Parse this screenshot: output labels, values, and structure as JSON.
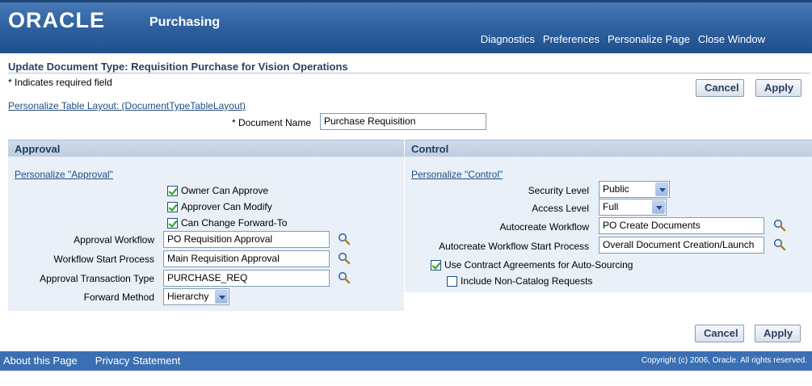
{
  "header": {
    "logo": "ORACLE",
    "app_name": "Purchasing",
    "global_links": [
      "Diagnostics",
      "Preferences",
      "Personalize Page",
      "Close Window"
    ]
  },
  "page": {
    "title": "Update Document Type: Requisition Purchase for Vision Operations",
    "required_note": "* Indicates required field",
    "cancel_label": "Cancel",
    "apply_label": "Apply",
    "personalize_table_link": "Personalize Table Layout: (DocumentTypeTableLayout)",
    "document_name_label": "* Document Name",
    "document_name_value": "Purchase Requisition"
  },
  "approval": {
    "heading": "Approval",
    "personalize_link": "Personalize \"Approval\"",
    "owner_can_approve": "Owner Can Approve",
    "approver_can_modify": "Approver Can Modify",
    "can_change_forward_to": "Can Change Forward-To",
    "workflow_label": "Approval Workflow",
    "workflow_value": "PO Requisition Approval",
    "start_process_label": "Workflow Start Process",
    "start_process_value": "Main Requisition Approval",
    "transaction_type_label": "Approval Transaction Type",
    "transaction_type_value": "PURCHASE_REQ",
    "forward_method_label": "Forward Method",
    "forward_method_value": "Hierarchy"
  },
  "control": {
    "heading": "Control",
    "personalize_link": "Personalize \"Control\"",
    "security_level_label": "Security Level",
    "security_level_value": "Public",
    "access_level_label": "Access Level",
    "access_level_value": "Full",
    "autocreate_workflow_label": "Autocreate Workflow",
    "autocreate_workflow_value": "PO Create Documents",
    "autocreate_start_label": "Autocreate Workflow Start Process",
    "autocreate_start_value": "Overall Document Creation/Launch",
    "use_contract_label": "Use Contract Agreements for Auto-Sourcing",
    "include_noncatalog_label": "Include Non-Catalog Requests"
  },
  "footer": {
    "about": "About this Page",
    "privacy": "Privacy Statement",
    "copyright": "Copyright (c) 2006, Oracle. All rights reserved."
  },
  "colors": {
    "header_blue": "#2d5f9e",
    "footer_blue": "#3a6fb3",
    "section_bg": "#eaf0f7",
    "link": "#1f4c80"
  }
}
